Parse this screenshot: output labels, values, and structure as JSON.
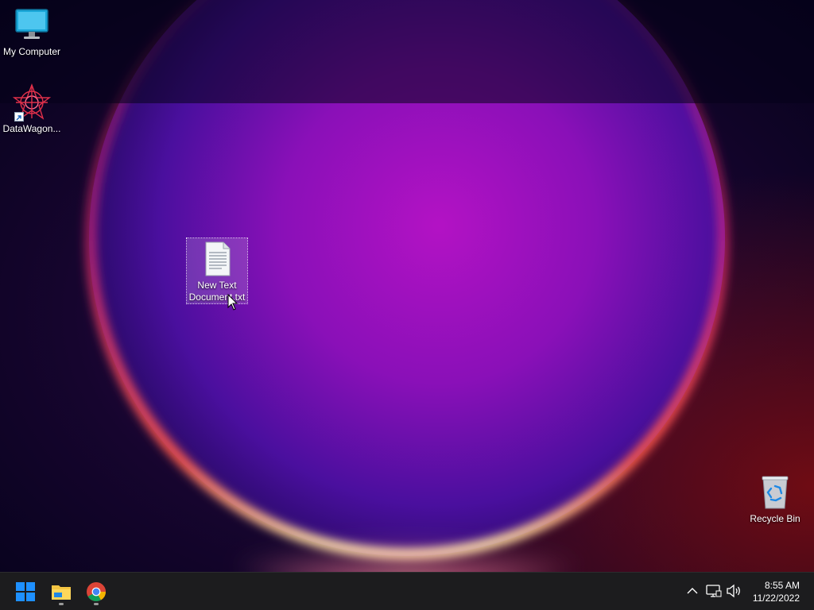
{
  "desktop": {
    "icons": [
      {
        "label": "My Computer",
        "icon": "monitor-icon"
      },
      {
        "label": "DataWagon...",
        "icon": "datawagon-app-icon"
      },
      {
        "label": "New Text Document.txt",
        "icon": "text-document-icon",
        "selected": true
      },
      {
        "label": "Recycle Bin",
        "icon": "recycle-bin-icon"
      }
    ]
  },
  "taskbar": {
    "apps": [
      {
        "name": "Start",
        "icon": "windows-start-icon"
      },
      {
        "name": "File Explorer",
        "icon": "folder-icon",
        "running": true
      },
      {
        "name": "Google Chrome",
        "icon": "chrome-icon",
        "running": true
      }
    ],
    "tray": [
      "chevron-up-icon",
      "network-icon",
      "volume-icon"
    ],
    "clock": {
      "time": "8:55 AM",
      "date": "11/22/2022"
    }
  },
  "colors": {
    "taskbar_bg": "#1c1c1e",
    "start_blue": "#1e90ff",
    "folder_yellow": "#f4c542"
  }
}
